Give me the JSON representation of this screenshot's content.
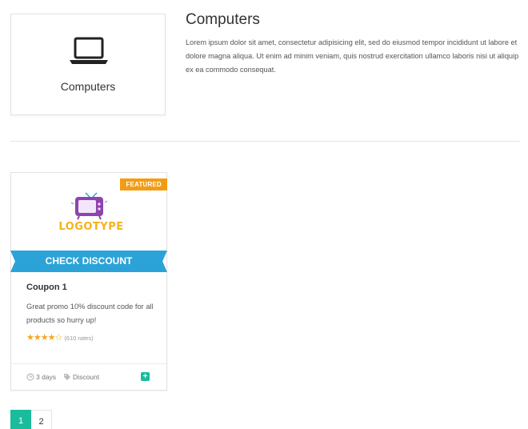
{
  "category": {
    "box_label": "Computers",
    "icon": "laptop-icon",
    "title": "Computers",
    "description": "Lorem ipsum dolor sit amet, consectetur adipisicing elit, sed do eiusmod tempor incididunt ut labore et dolore magna aliqua. Ut enim ad minim veniam, quis nostrud exercitation ullamco laboris nisi ut aliquip ex ea commodo consequat."
  },
  "coupon": {
    "badge": "FEATURED",
    "logo_text": "LOGOTYPE",
    "logo_icon": "tv-icon",
    "button_label": "CHECK DISCOUNT",
    "title": "Coupon 1",
    "description": "Great promo 10% discount code for all products so hurry up!",
    "rating": 4,
    "rating_max": 5,
    "rates": "(610 rates)",
    "expires": "3 days",
    "tag": "Discount",
    "colors": {
      "featured": "#f39c12",
      "ribbon": "#2ba3d9",
      "accent": "#1abc9c",
      "stars": "#f5a623"
    }
  },
  "pagination": {
    "pages": [
      "1",
      "2"
    ],
    "active": "1"
  }
}
